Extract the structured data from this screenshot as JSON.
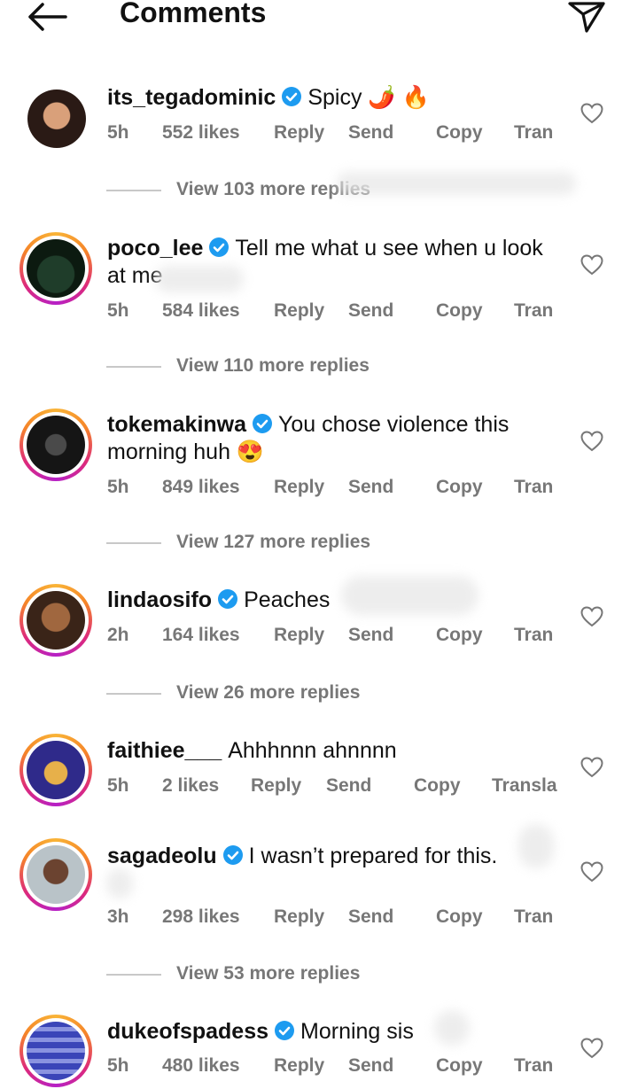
{
  "header": {
    "title": "Comments"
  },
  "actions": {
    "reply": "Reply",
    "send": "Send",
    "copy": "Copy"
  },
  "comments": [
    {
      "username": "its_tegadominic",
      "text": "Spicy 🌶️ 🔥",
      "text2": "",
      "time": "5h",
      "likes": "552 likes",
      "translate": "Tran",
      "view_replies": "View 103 more replies"
    },
    {
      "username": "poco_lee",
      "text": "Tell me what u see when u look",
      "text2": "at me",
      "time": "5h",
      "likes": "584 likes",
      "translate": "Tran",
      "view_replies": "View 110 more replies"
    },
    {
      "username": "tokemakinwa",
      "text": "You chose violence this",
      "text2": "morning huh 😍",
      "time": "5h",
      "likes": "849 likes",
      "translate": "Tran",
      "view_replies": "View 127 more replies"
    },
    {
      "username": "lindaosifo",
      "text": "Peaches",
      "text2": "",
      "time": "2h",
      "likes": "164 likes",
      "translate": "Tran",
      "view_replies": "View 26 more replies"
    },
    {
      "username": "faithiee___",
      "text": "Ahhhnnn ahnnnn",
      "text2": "",
      "time": "5h",
      "likes": "2 likes",
      "translate": "Transla",
      "view_replies": ""
    },
    {
      "username": "sagadeolu",
      "text": "I wasn’t prepared for this.",
      "text2": "",
      "time": "3h",
      "likes": "298 likes",
      "translate": "Tran",
      "view_replies": "View 53 more replies"
    },
    {
      "username": "dukeofspadess",
      "text": "Morning sis",
      "text2": "",
      "time": "5h",
      "likes": "480 likes",
      "translate": "Tran",
      "view_replies": ""
    }
  ],
  "colors": {
    "verified": "#1d9bf0",
    "secondary_text": "#777777",
    "ring_start": "#f9b437",
    "ring_end": "#b620c6"
  }
}
